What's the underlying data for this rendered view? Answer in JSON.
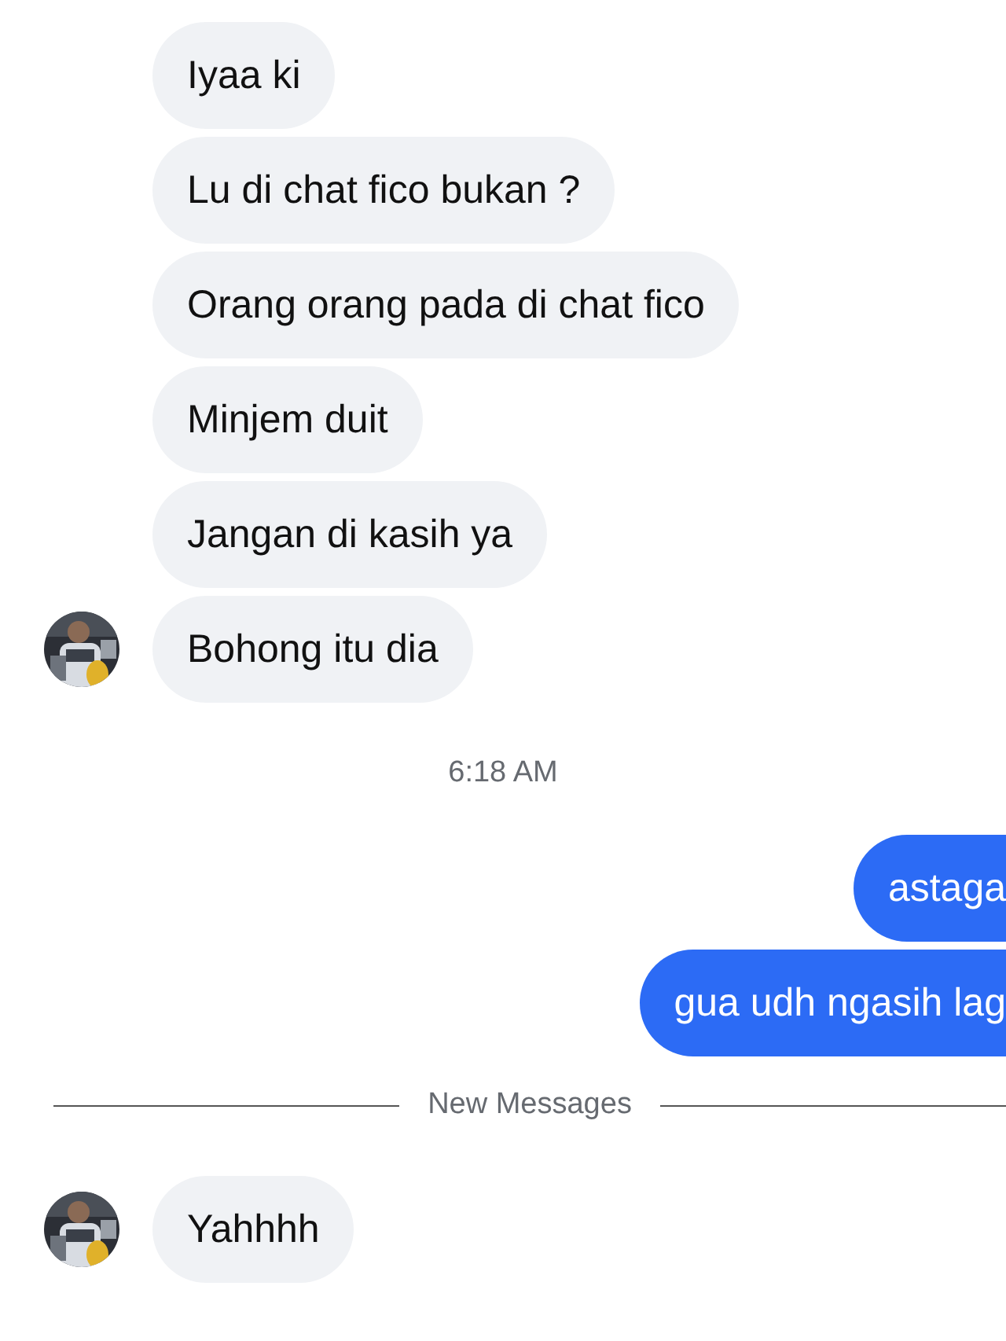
{
  "messages": [
    {
      "kind": "incoming",
      "text": "Iyaa ki",
      "avatar": false
    },
    {
      "kind": "incoming",
      "text": "Lu di chat fico bukan ?",
      "avatar": false
    },
    {
      "kind": "incoming",
      "text": "Orang orang pada di chat fico",
      "avatar": false
    },
    {
      "kind": "incoming",
      "text": "Minjem duit",
      "avatar": false
    },
    {
      "kind": "incoming",
      "text": "Jangan di kasih ya",
      "avatar": false
    },
    {
      "kind": "incoming",
      "text": "Bohong itu dia",
      "avatar": true
    },
    {
      "kind": "time",
      "text": "6:18 AM"
    },
    {
      "kind": "outgoing",
      "text": "astaga"
    },
    {
      "kind": "outgoing",
      "text": "gua udh ngasih lag"
    },
    {
      "kind": "divider",
      "text": "New Messages"
    },
    {
      "kind": "incoming",
      "text": "Yahhhh",
      "avatar": true
    }
  ]
}
